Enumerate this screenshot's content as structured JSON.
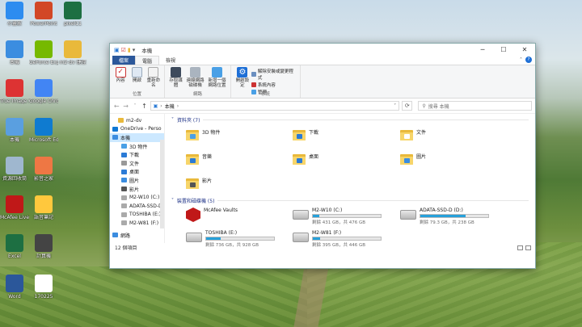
{
  "desktop": {
    "icons": [
      {
        "label": "小畫家",
        "color": "#2d8cf0"
      },
      {
        "label": "PowerPoint",
        "color": "#d24726"
      },
      {
        "label": "pixel11",
        "color": "#1d6f42"
      },
      {
        "label": "本機",
        "color": "#3b8de0"
      },
      {
        "label": "GeForce Experience",
        "color": "#76b900"
      },
      {
        "label": "m2-dv 捷徑",
        "color": "#e9b93b"
      },
      {
        "label": "True Image 2019",
        "color": "#d33"
      },
      {
        "label": "Google Chrome",
        "color": "#4285f4"
      },
      {
        "label": "本機",
        "color": "#5a9fe0"
      },
      {
        "label": "Microsoft Edge",
        "color": "#0f7bd0"
      },
      {
        "label": "資源回收筒",
        "color": "#9fb7cf"
      },
      {
        "label": "影音之家",
        "color": "#e74"
      },
      {
        "label": "McAfee LiveSafe",
        "color": "#c01818"
      },
      {
        "label": "語音筆記",
        "color": "#ffc83d"
      },
      {
        "label": "Excel",
        "color": "#1d6f42"
      },
      {
        "label": "計算機",
        "color": "#444"
      },
      {
        "label": "Word",
        "color": "#2b579a"
      },
      {
        "label": "170225",
        "color": "#fff"
      }
    ]
  },
  "window": {
    "title": "本機",
    "tabs": [
      "檔案",
      "電腦",
      "檢視"
    ],
    "ribbon": {
      "location_group": "位置",
      "network_group": "網路",
      "system_group": "系統",
      "buttons": {
        "properties": "內容",
        "open": "開啟",
        "rename": "重新命名",
        "access_media": "存取媒體",
        "map_network_drive": "連線網路磁碟機",
        "add_network_location": "新增一個網路位置",
        "open_settings": "開啟設定"
      },
      "system_items": [
        "解除安裝或變更程式",
        "系統內容",
        "管理"
      ]
    },
    "address": {
      "path": "本機",
      "search_placeholder": "搜尋 本機"
    },
    "nav_pane": [
      {
        "label": "m2-dv",
        "color": "#e9b93b"
      },
      {
        "label": "OneDrive - Perso",
        "color": "#0f78d4"
      },
      {
        "label": "本機",
        "color": "#3b8de0",
        "selected": true
      },
      {
        "label": "3D 物件",
        "color": "#4aa0e6"
      },
      {
        "label": "下載",
        "color": "#2b7bd6"
      },
      {
        "label": "文件",
        "color": "#999"
      },
      {
        "label": "桌面",
        "color": "#2b7bd6"
      },
      {
        "label": "圖片",
        "color": "#3b8de0"
      },
      {
        "label": "影片",
        "color": "#555"
      },
      {
        "label": "M2-W10 (C:)",
        "color": "#aaa"
      },
      {
        "label": "ADATA-SSD-D (D",
        "color": "#aaa"
      },
      {
        "label": "TOSHIBA (E:)",
        "color": "#aaa"
      },
      {
        "label": "M2-W81 (F:)",
        "color": "#aaa"
      },
      {
        "label": "網路",
        "color": "#3b8de0"
      }
    ],
    "folders_header": "資料夾 (7)",
    "folders": [
      {
        "label": "3D 物件",
        "badge": "#4aa0e6"
      },
      {
        "label": "下載",
        "badge": "#2b7bd6"
      },
      {
        "label": "文件",
        "badge": "#ffffff"
      },
      {
        "label": "音樂",
        "badge": "#2b7bd6"
      },
      {
        "label": "桌面",
        "badge": "#2b7bd6"
      },
      {
        "label": "圖片",
        "badge": "#3b8de0"
      },
      {
        "label": "影片",
        "badge": "#555555"
      }
    ],
    "drives_header": "裝置和磁碟機 (5)",
    "drives": [
      {
        "label": "McAfee Vaults",
        "type": "mcafee"
      },
      {
        "label": "M2-W10 (C:)",
        "free": "剩餘 431 GB，共 476 GB",
        "used_fraction": 0.1
      },
      {
        "label": "ADATA-SSD-D (D:)",
        "free": "剩餘 79.3 GB，共 238 GB",
        "used_fraction": 0.67
      },
      {
        "label": "TOSHIBA (E:)",
        "free": "剩餘 736 GB，共 928 GB",
        "used_fraction": 0.21
      },
      {
        "label": "M2-W81 (F:)",
        "free": "剩餘 395 GB，共 446 GB",
        "used_fraction": 0.11
      }
    ],
    "status": "12 個項目"
  }
}
